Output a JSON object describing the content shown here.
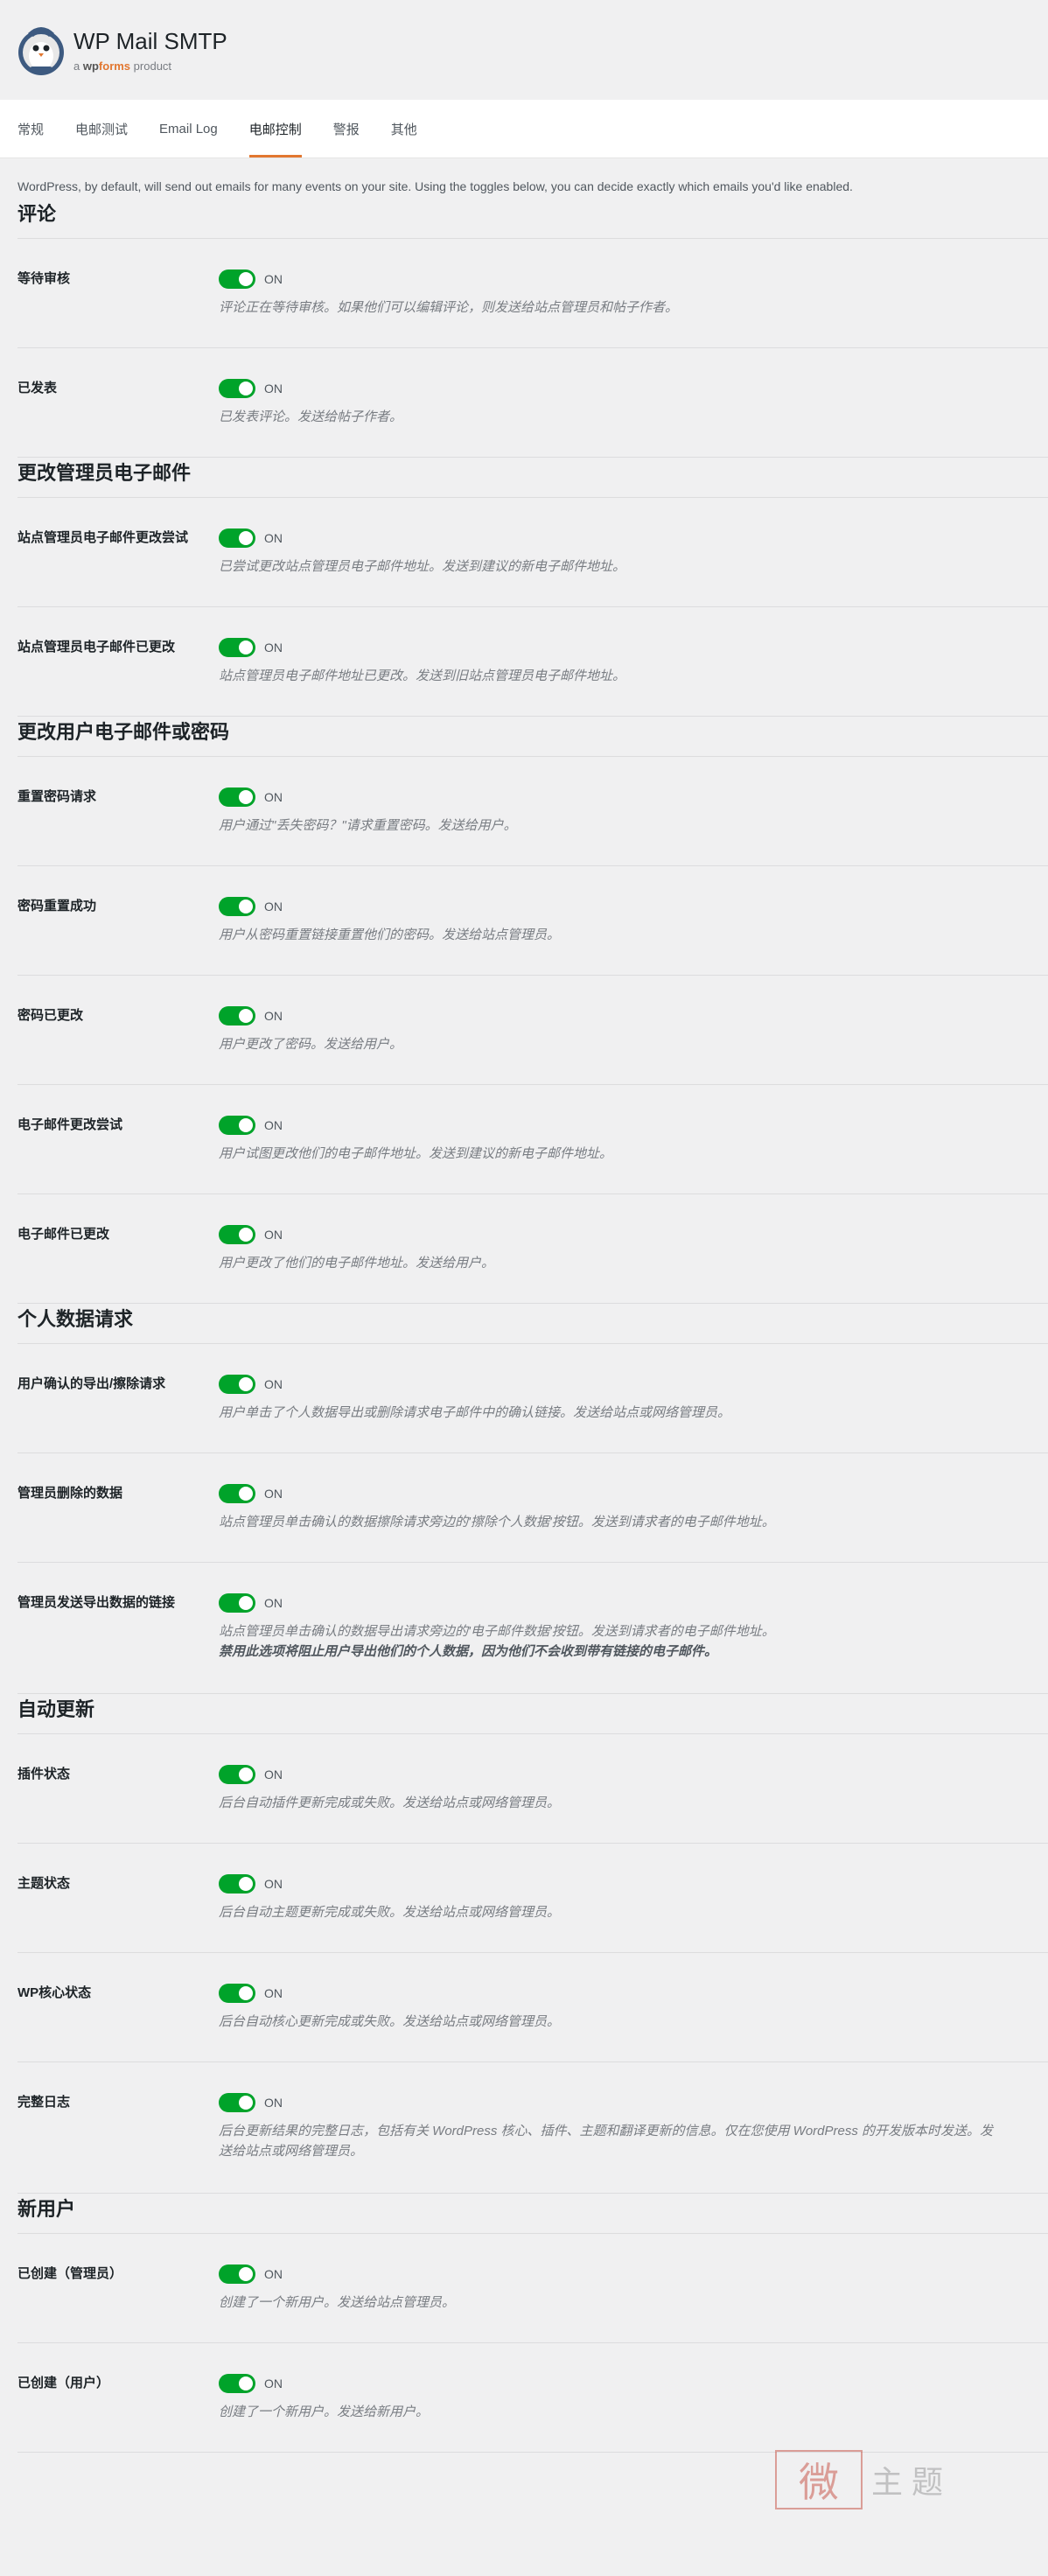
{
  "brand": {
    "title": "WP Mail SMTP",
    "sub_a": "a",
    "sub_wp": "wp",
    "sub_forms": "forms",
    "sub_product": "product"
  },
  "tabs": [
    {
      "label": "常规",
      "active": false
    },
    {
      "label": "电邮测试",
      "active": false
    },
    {
      "label": "Email Log",
      "active": false
    },
    {
      "label": "电邮控制",
      "active": true
    },
    {
      "label": "警报",
      "active": false
    },
    {
      "label": "其他",
      "active": false
    }
  ],
  "intro": "WordPress, by default, will send out emails for many events on your site. Using the toggles below, you can decide exactly which emails you'd like enabled.",
  "toggle_label": "ON",
  "sections": [
    {
      "title": "评论",
      "rows": [
        {
          "label": "等待审核",
          "desc": "评论正在等待审核。如果他们可以编辑评论，则发送给站点管理员和帖子作者。"
        },
        {
          "label": "已发表",
          "desc": "已发表评论。发送给帖子作者。"
        }
      ]
    },
    {
      "title": "更改管理员电子邮件",
      "rows": [
        {
          "label": "站点管理员电子邮件更改尝试",
          "desc": "已尝试更改站点管理员电子邮件地址。发送到建议的新电子邮件地址。"
        },
        {
          "label": "站点管理员电子邮件已更改",
          "desc": "站点管理员电子邮件地址已更改。发送到旧站点管理员电子邮件地址。"
        }
      ]
    },
    {
      "title": "更改用户电子邮件或密码",
      "rows": [
        {
          "label": "重置密码请求",
          "desc": "用户通过\"丢失密码？\"请求重置密码。发送给用户。"
        },
        {
          "label": "密码重置成功",
          "desc": "用户从密码重置链接重置他们的密码。发送给站点管理员。"
        },
        {
          "label": "密码已更改",
          "desc": "用户更改了密码。发送给用户。"
        },
        {
          "label": "电子邮件更改尝试",
          "desc": "用户试图更改他们的电子邮件地址。发送到建议的新电子邮件地址。"
        },
        {
          "label": "电子邮件已更改",
          "desc": "用户更改了他们的电子邮件地址。发送给用户。"
        }
      ]
    },
    {
      "title": "个人数据请求",
      "rows": [
        {
          "label": "用户确认的导出/擦除请求",
          "desc": "用户单击了个人数据导出或删除请求电子邮件中的确认链接。发送给站点或网络管理员。"
        },
        {
          "label": "管理员删除的数据",
          "desc": "站点管理员单击确认的数据擦除请求旁边的'擦除个人数据'按钮。发送到请求者的电子邮件地址。"
        },
        {
          "label": "管理员发送导出数据的链接",
          "desc": "站点管理员单击确认的数据导出请求旁边的'电子邮件数据'按钮。发送到请求者的电子邮件地址。",
          "desc_bold": "禁用此选项将阻止用户导出他们的个人数据，因为他们不会收到带有链接的电子邮件。"
        }
      ]
    },
    {
      "title": "自动更新",
      "rows": [
        {
          "label": "插件状态",
          "desc": "后台自动插件更新完成或失败。发送给站点或网络管理员。"
        },
        {
          "label": "主题状态",
          "desc": "后台自动主题更新完成或失败。发送给站点或网络管理员。"
        },
        {
          "label": "WP核心状态",
          "desc": "后台自动核心更新完成或失败。发送给站点或网络管理员。"
        },
        {
          "label": "完整日志",
          "desc": "后台更新结果的完整日志，包括有关 WordPress 核心、插件、主题和翻译更新的信息。仅在您使用 WordPress 的开发版本时发送。发送给站点或网络管理员。"
        }
      ]
    },
    {
      "title": "新用户",
      "rows": [
        {
          "label": "已创建（管理员）",
          "desc": "创建了一个新用户。发送给站点管理员。"
        },
        {
          "label": "已创建（用户）",
          "desc": "创建了一个新用户。发送给新用户。"
        }
      ]
    }
  ],
  "watermark": {
    "box": "微",
    "text": "主题"
  },
  "colors": {
    "toggle_on": "#00a32a",
    "tab_active_underline": "#e27730",
    "page_bg": "#f0f0f1"
  }
}
